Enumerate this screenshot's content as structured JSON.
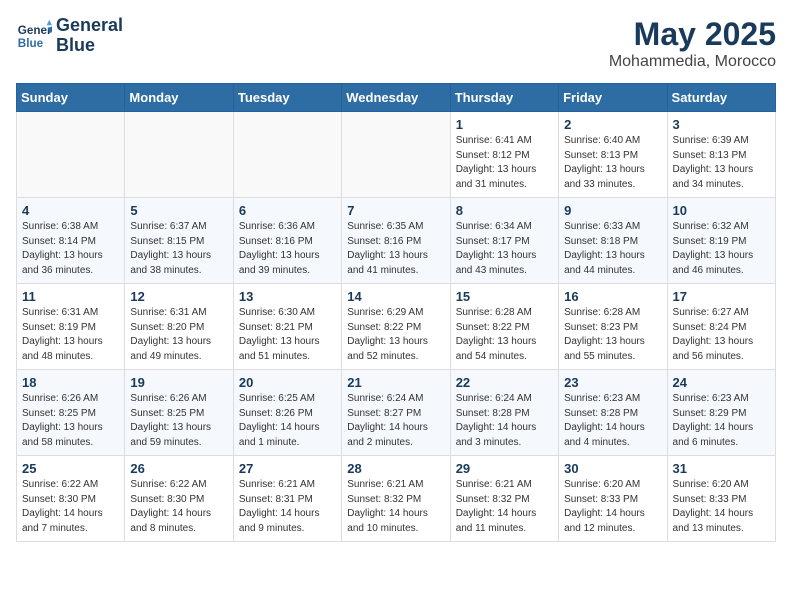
{
  "logo": {
    "line1": "General",
    "line2": "Blue"
  },
  "title": "May 2025",
  "subtitle": "Mohammedia, Morocco",
  "weekdays": [
    "Sunday",
    "Monday",
    "Tuesday",
    "Wednesday",
    "Thursday",
    "Friday",
    "Saturday"
  ],
  "rows": [
    [
      {
        "day": "",
        "info": ""
      },
      {
        "day": "",
        "info": ""
      },
      {
        "day": "",
        "info": ""
      },
      {
        "day": "",
        "info": ""
      },
      {
        "day": "1",
        "info": "Sunrise: 6:41 AM\nSunset: 8:12 PM\nDaylight: 13 hours\nand 31 minutes."
      },
      {
        "day": "2",
        "info": "Sunrise: 6:40 AM\nSunset: 8:13 PM\nDaylight: 13 hours\nand 33 minutes."
      },
      {
        "day": "3",
        "info": "Sunrise: 6:39 AM\nSunset: 8:13 PM\nDaylight: 13 hours\nand 34 minutes."
      }
    ],
    [
      {
        "day": "4",
        "info": "Sunrise: 6:38 AM\nSunset: 8:14 PM\nDaylight: 13 hours\nand 36 minutes."
      },
      {
        "day": "5",
        "info": "Sunrise: 6:37 AM\nSunset: 8:15 PM\nDaylight: 13 hours\nand 38 minutes."
      },
      {
        "day": "6",
        "info": "Sunrise: 6:36 AM\nSunset: 8:16 PM\nDaylight: 13 hours\nand 39 minutes."
      },
      {
        "day": "7",
        "info": "Sunrise: 6:35 AM\nSunset: 8:16 PM\nDaylight: 13 hours\nand 41 minutes."
      },
      {
        "day": "8",
        "info": "Sunrise: 6:34 AM\nSunset: 8:17 PM\nDaylight: 13 hours\nand 43 minutes."
      },
      {
        "day": "9",
        "info": "Sunrise: 6:33 AM\nSunset: 8:18 PM\nDaylight: 13 hours\nand 44 minutes."
      },
      {
        "day": "10",
        "info": "Sunrise: 6:32 AM\nSunset: 8:19 PM\nDaylight: 13 hours\nand 46 minutes."
      }
    ],
    [
      {
        "day": "11",
        "info": "Sunrise: 6:31 AM\nSunset: 8:19 PM\nDaylight: 13 hours\nand 48 minutes."
      },
      {
        "day": "12",
        "info": "Sunrise: 6:31 AM\nSunset: 8:20 PM\nDaylight: 13 hours\nand 49 minutes."
      },
      {
        "day": "13",
        "info": "Sunrise: 6:30 AM\nSunset: 8:21 PM\nDaylight: 13 hours\nand 51 minutes."
      },
      {
        "day": "14",
        "info": "Sunrise: 6:29 AM\nSunset: 8:22 PM\nDaylight: 13 hours\nand 52 minutes."
      },
      {
        "day": "15",
        "info": "Sunrise: 6:28 AM\nSunset: 8:22 PM\nDaylight: 13 hours\nand 54 minutes."
      },
      {
        "day": "16",
        "info": "Sunrise: 6:28 AM\nSunset: 8:23 PM\nDaylight: 13 hours\nand 55 minutes."
      },
      {
        "day": "17",
        "info": "Sunrise: 6:27 AM\nSunset: 8:24 PM\nDaylight: 13 hours\nand 56 minutes."
      }
    ],
    [
      {
        "day": "18",
        "info": "Sunrise: 6:26 AM\nSunset: 8:25 PM\nDaylight: 13 hours\nand 58 minutes."
      },
      {
        "day": "19",
        "info": "Sunrise: 6:26 AM\nSunset: 8:25 PM\nDaylight: 13 hours\nand 59 minutes."
      },
      {
        "day": "20",
        "info": "Sunrise: 6:25 AM\nSunset: 8:26 PM\nDaylight: 14 hours\nand 1 minute."
      },
      {
        "day": "21",
        "info": "Sunrise: 6:24 AM\nSunset: 8:27 PM\nDaylight: 14 hours\nand 2 minutes."
      },
      {
        "day": "22",
        "info": "Sunrise: 6:24 AM\nSunset: 8:28 PM\nDaylight: 14 hours\nand 3 minutes."
      },
      {
        "day": "23",
        "info": "Sunrise: 6:23 AM\nSunset: 8:28 PM\nDaylight: 14 hours\nand 4 minutes."
      },
      {
        "day": "24",
        "info": "Sunrise: 6:23 AM\nSunset: 8:29 PM\nDaylight: 14 hours\nand 6 minutes."
      }
    ],
    [
      {
        "day": "25",
        "info": "Sunrise: 6:22 AM\nSunset: 8:30 PM\nDaylight: 14 hours\nand 7 minutes."
      },
      {
        "day": "26",
        "info": "Sunrise: 6:22 AM\nSunset: 8:30 PM\nDaylight: 14 hours\nand 8 minutes."
      },
      {
        "day": "27",
        "info": "Sunrise: 6:21 AM\nSunset: 8:31 PM\nDaylight: 14 hours\nand 9 minutes."
      },
      {
        "day": "28",
        "info": "Sunrise: 6:21 AM\nSunset: 8:32 PM\nDaylight: 14 hours\nand 10 minutes."
      },
      {
        "day": "29",
        "info": "Sunrise: 6:21 AM\nSunset: 8:32 PM\nDaylight: 14 hours\nand 11 minutes."
      },
      {
        "day": "30",
        "info": "Sunrise: 6:20 AM\nSunset: 8:33 PM\nDaylight: 14 hours\nand 12 minutes."
      },
      {
        "day": "31",
        "info": "Sunrise: 6:20 AM\nSunset: 8:33 PM\nDaylight: 14 hours\nand 13 minutes."
      }
    ]
  ]
}
